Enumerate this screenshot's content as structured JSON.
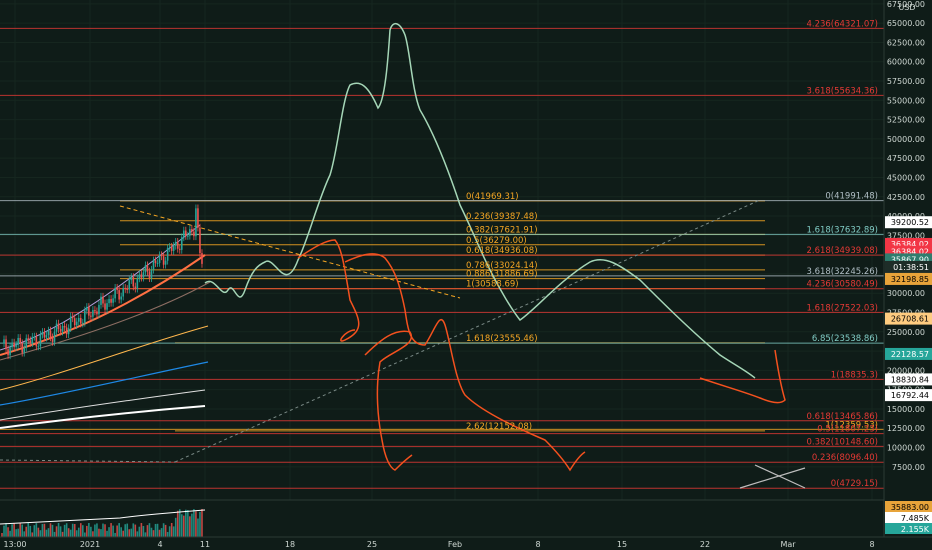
{
  "chart_data": {
    "type": "line",
    "currency": "USD",
    "y_ticks": [
      "67500.00",
      "65000.00",
      "62500.00",
      "60000.00",
      "57500.00",
      "55000.00",
      "52500.00",
      "50000.00",
      "47500.00",
      "45000.00",
      "42500.00",
      "40000.00",
      "37500.00",
      "35000.00",
      "32500.00",
      "30000.00",
      "27500.00",
      "25000.00",
      "22500.00",
      "20000.00",
      "17500.00",
      "15000.00",
      "12500.00",
      "10000.00",
      "7500.00"
    ],
    "y_tick_values": [
      67500,
      65000,
      62500,
      60000,
      57500,
      55000,
      52500,
      50000,
      47500,
      45000,
      42500,
      40000,
      37500,
      35000,
      32500,
      30000,
      27500,
      25000,
      22500,
      20000,
      17500,
      15000,
      12500,
      10000,
      7500
    ],
    "ylim": [
      3200,
      68000
    ],
    "x_ticks": [
      "13:00",
      "2021",
      "4",
      "11",
      "18",
      "25",
      "Feb",
      "8",
      "15",
      "22",
      "Mar",
      "8"
    ],
    "fib_left": [
      {
        "label": "0(41969.31)",
        "value": 41969.31
      },
      {
        "label": "0.236(39387.48)",
        "value": 39387.48
      },
      {
        "label": "0.382(37621.91)",
        "value": 37621.91
      },
      {
        "label": "0.5(36279.00)",
        "value": 36279.0
      },
      {
        "label": "0.618(34936.08)",
        "value": 34936.08
      },
      {
        "label": "0.786(33024.14)",
        "value": 33024.14
      },
      {
        "label": "0.886(31886.69)",
        "value": 31886.69
      },
      {
        "label": "1(30588.69)",
        "value": 30588.69
      },
      {
        "label": "1.618(23555.46)",
        "value": 23555.46
      },
      {
        "label": "2.62(12152.08)",
        "value": 12152.08
      }
    ],
    "fib_right": [
      {
        "label": "4.236(64321.07)",
        "value": 64321.07
      },
      {
        "label": "3.618(55634.36)",
        "value": 55634.36
      },
      {
        "label": "0(41991.48)",
        "value": 41991.48
      },
      {
        "label": "1.618(37632.89)",
        "value": 37632.89
      },
      {
        "label": "2.618(34939.08)",
        "value": 34939.08
      },
      {
        "label": "3.618(32245.26)",
        "value": 32245.26
      },
      {
        "label": "4.236(30580.49)",
        "value": 30580.49
      },
      {
        "label": "1.618(27522.03)",
        "value": 27522.03
      },
      {
        "label": "6.85(23538.86)",
        "value": 23538.86
      },
      {
        "label": "1(18835.3)",
        "value": 18835.3
      },
      {
        "label": "0.618(13465.86)",
        "value": 13465.86
      },
      {
        "label": "1(12359.53)",
        "value": 12359.53
      },
      {
        "label": "0.5(11807.23)",
        "value": 11807.23
      },
      {
        "label": "0.382(10148.60)",
        "value": 10148.6
      },
      {
        "label": "0.236(8096.40)",
        "value": 8096.4
      },
      {
        "label": "0(4729.15)",
        "value": 4729.15
      }
    ],
    "price_tags": [
      {
        "label": "39200.52",
        "value": 39200.52,
        "color": "#ffffff",
        "text": "#000000"
      },
      {
        "label": "36384.02",
        "value": 36384.02,
        "color": "#f23645",
        "text": "#ffffff"
      },
      {
        "label": "36384.02",
        "value": 35380,
        "color": "#f23645",
        "text": "#ffffff"
      },
      {
        "label": "35867.90",
        "value": 34380,
        "color": "#2e7d6e",
        "text": "#ffffff"
      },
      {
        "label": "01:38:51",
        "value": 33400,
        "color": "#1e2d28",
        "text": "#ffffff"
      },
      {
        "label": "32198.85",
        "value": 31850,
        "color": "#e8a43a",
        "text": "#000000"
      },
      {
        "label": "26708.61",
        "value": 26708.61,
        "color": "#ffcc80",
        "text": "#000000"
      },
      {
        "label": "22128.57",
        "value": 22128.57,
        "color": "#26a69a",
        "text": "#ffffff"
      },
      {
        "label": "18830.84",
        "value": 18830.84,
        "color": "#ffffff",
        "text": "#000000"
      },
      {
        "label": "16792.44",
        "value": 16792.44,
        "color": "#ffffff",
        "text": "#000000"
      }
    ],
    "volume_labels": [
      "35883.00",
      "7.485K",
      "2.155K"
    ],
    "colors": {
      "background": "#0f1c18",
      "fib": "#f5a623",
      "red": "#e53935",
      "green_path": "#a5d6b7",
      "orange_path": "#f4511e"
    }
  }
}
